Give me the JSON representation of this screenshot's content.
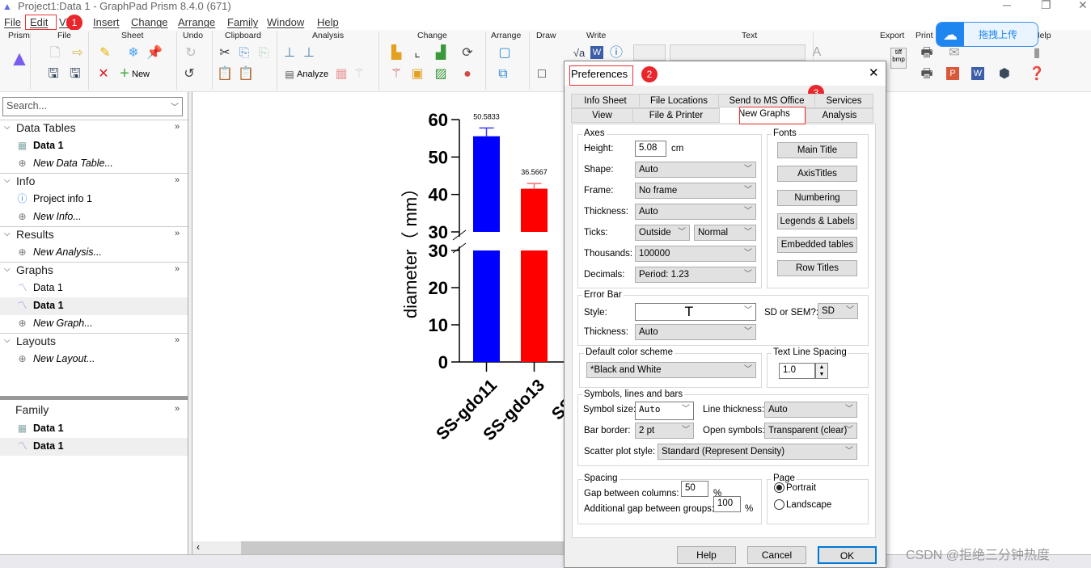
{
  "window": {
    "title": "Project1:Data 1 - GraphPad Prism 8.4.0 (671)",
    "minimize": "─",
    "restore": "❐",
    "close": "✕"
  },
  "menu": [
    "File",
    "Edit",
    "View",
    "Insert",
    "Change",
    "Arrange",
    "Family",
    "Window",
    "Help"
  ],
  "annotations": {
    "b1": "1",
    "b2": "2",
    "b3": "3"
  },
  "ribbon": {
    "groups": [
      "Prism",
      "File",
      "Sheet",
      "Undo",
      "Clipboard",
      "Analysis",
      "Change",
      "Arrange",
      "Draw",
      "Write",
      "Text",
      "Export",
      "Print",
      "Help"
    ],
    "new_label": "New",
    "analyze_label": "Analyze",
    "export_icon_text": "tiff bmp"
  },
  "baidu": {
    "label": "拖拽上传",
    "icon": "cloud-icon"
  },
  "sidebar": {
    "search_placeholder": "Search...",
    "sections": [
      {
        "title": "Data Tables",
        "items": [
          "Data 1",
          "New Data Table..."
        ]
      },
      {
        "title": "Info",
        "items": [
          "Project info 1",
          "New Info..."
        ]
      },
      {
        "title": "Results",
        "items": [
          "New Analysis..."
        ]
      },
      {
        "title": "Graphs",
        "items": [
          "Data 1",
          "Data 1",
          "New Graph..."
        ]
      },
      {
        "title": "Layouts",
        "items": [
          "New Layout..."
        ]
      }
    ],
    "family": {
      "title": "Family",
      "items": [
        "Data 1",
        "Data 1"
      ]
    },
    "more": "»"
  },
  "graph": {
    "ylabel": "diameter（ mm）",
    "upper_ticks": [
      30,
      40,
      50,
      60
    ],
    "lower_ticks": [
      0,
      10,
      20,
      30
    ],
    "categories": [
      "SS-gdo11",
      "SS-gdo13",
      "SS-gd"
    ],
    "bars": [
      {
        "value": 50.5833,
        "error": 2.2,
        "label": "50.5833",
        "color": "#0000ff",
        "errcolor": "#3a3aff"
      },
      {
        "value": 36.5667,
        "error": 1.4,
        "label": "36.5667",
        "color": "#ff0000",
        "errcolor": "#ff6a6a"
      }
    ]
  },
  "dialog": {
    "title": "Preferences",
    "close": "✕",
    "tabs_row1": [
      "Info Sheet",
      "File Locations",
      "Send to MS Office",
      "Services"
    ],
    "tabs_row2": [
      "View",
      "File & Printer",
      "New Graphs",
      "Analysis"
    ],
    "axes": {
      "legend": "Axes",
      "height_label": "Height:",
      "height": "5.08",
      "height_unit": "cm",
      "shape_label": "Shape:",
      "shape": "Auto",
      "frame_label": "Frame:",
      "frame": "No frame",
      "thickness_label": "Thickness:",
      "thickness": "Auto",
      "ticks_label": "Ticks:",
      "ticks_dir": "Outside",
      "ticks_len": "Normal",
      "thousands_label": "Thousands:",
      "thousands": "100000",
      "decimals_label": "Decimals:",
      "decimals": "Period: 1.23"
    },
    "fonts": {
      "legend": "Fonts",
      "buttons": [
        "Main Title",
        "AxisTitles",
        "Numbering",
        "Legends & Labels",
        "Embedded tables",
        "Row Titles"
      ]
    },
    "errorbar": {
      "legend": "Error Bar",
      "style_label": "Style:",
      "style": "",
      "thickness_label": "Thickness:",
      "thickness": "Auto",
      "sdsem_label": "SD or SEM?:",
      "sdsem": "SD"
    },
    "color": {
      "legend": "Default color scheme",
      "value": "*Black and White"
    },
    "spacing_text": {
      "legend": "Text Line Spacing",
      "value": "1.0"
    },
    "symbols": {
      "legend": "Symbols, lines and bars",
      "size_label": "Symbol size:",
      "size": "Auto",
      "line_label": "Line thickness:",
      "line": "Auto",
      "border_label": "Bar border:",
      "border": "2 pt",
      "open_label": "Open symbols:",
      "open": "Transparent (clear)",
      "scatter_label": "Scatter plot style:",
      "scatter": "Standard (Represent Density)"
    },
    "spacing": {
      "legend": "Spacing",
      "gap_label": "Gap between columns:",
      "gap": "50",
      "add_label": "Additional gap between groups:",
      "add": "100",
      "pct": "%"
    },
    "page": {
      "legend": "Page",
      "portrait": "Portrait",
      "landscape": "Landscape",
      "selected": "Portrait"
    },
    "buttons": {
      "help": "Help",
      "cancel": "Cancel",
      "ok": "OK"
    }
  },
  "watermark": "CSDN @拒绝三分钟热度"
}
